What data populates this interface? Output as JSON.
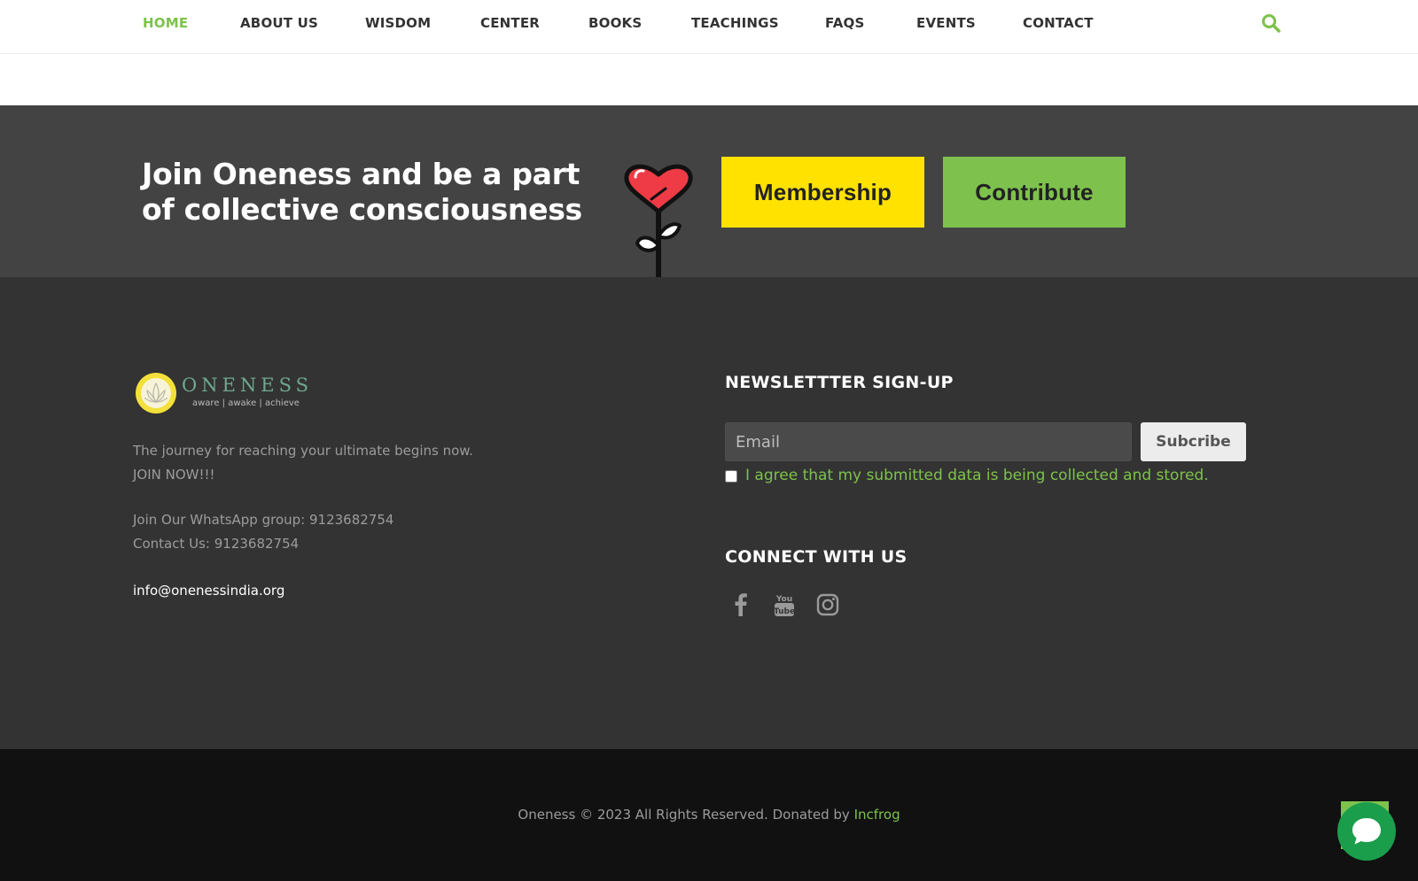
{
  "nav": {
    "items": [
      {
        "label": "HOME",
        "active": true
      },
      {
        "label": "ABOUT US",
        "active": false
      },
      {
        "label": "WISDOM",
        "active": false
      },
      {
        "label": "CENTER",
        "active": false
      },
      {
        "label": "BOOKS",
        "active": false
      },
      {
        "label": "TEACHINGS",
        "active": false
      },
      {
        "label": "FAQS",
        "active": false
      },
      {
        "label": "EVENTS",
        "active": false
      },
      {
        "label": "CONTACT",
        "active": false
      }
    ],
    "search_icon": "search-icon"
  },
  "cta": {
    "title": "Join Oneness and be a part of collective consciousness",
    "illustration_icon": "heart-flower-icon",
    "membership_label": "Membership",
    "contribute_label": "Contribute"
  },
  "footer": {
    "logo": {
      "name": "ONENESS",
      "tagline": "aware | awake | achieve"
    },
    "journey_text": "The journey for reaching your ultimate begins now.",
    "join_text": "JOIN NOW!!!",
    "whatsapp_text": "Join Our WhatsApp group: 9123682754",
    "contact_text": "Contact Us: 9123682754",
    "email": "info@onenessindia.org",
    "newsletter": {
      "title": "NEWSLETTTER SIGN-UP",
      "email_placeholder": "Email",
      "subscribe_label": "Subcribe",
      "agree_label": "I agree that my submitted data is being collected and stored."
    },
    "connect": {
      "title": "CONNECT WITH US",
      "icons": [
        "facebook-icon",
        "youtube-icon",
        "instagram-icon"
      ]
    }
  },
  "bottom": {
    "copyright": "Oneness © 2023 All Rights Reserved. Donated by ",
    "credit_link": "Incfrog"
  },
  "colors": {
    "accent_green": "#7dc24b",
    "membership_yellow": "#ffe200",
    "contribute_green": "#7ec24d",
    "cta_bg": "#434343",
    "footer_bg": "#333333",
    "bottom_bg": "#111111",
    "chat_green": "#1a9e4b"
  }
}
